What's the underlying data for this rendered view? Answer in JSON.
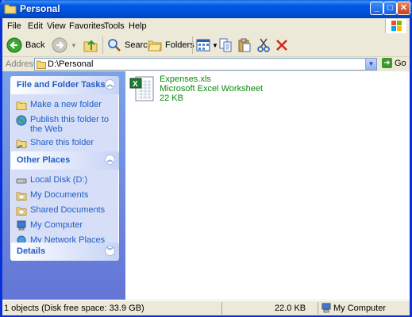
{
  "window": {
    "title": "Personal"
  },
  "menu": [
    "File",
    "Edit",
    "View",
    "Favorites",
    "Tools",
    "Help"
  ],
  "toolbar": {
    "back_label": "Back",
    "search_label": "Search",
    "folders_label": "Folders"
  },
  "address": {
    "label": "Address",
    "value": "D:\\Personal",
    "go_label": "Go"
  },
  "file_folder_tasks": {
    "title": "File and Folder Tasks",
    "items": [
      "Make a new folder",
      "Publish this folder to the Web",
      "Share this folder"
    ]
  },
  "other_places": {
    "title": "Other Places",
    "items": [
      "Local Disk (D:)",
      "My Documents",
      "Shared Documents",
      "My Computer",
      "My Network Places"
    ]
  },
  "details": {
    "title": "Details"
  },
  "files": [
    {
      "name": "Expenses.xls",
      "type": "Microsoft Excel Worksheet",
      "size": "22 KB",
      "icon": "excel-file-icon"
    }
  ],
  "status": {
    "objects": "1 objects (Disk free space: 33.9 GB)",
    "size": "22.0 KB",
    "location": "My Computer"
  },
  "colors": {
    "titlebar": "#0058e6",
    "task_pane": "#6f8ae0",
    "link": "#215dc6",
    "selected_file": "#0a8a0a"
  }
}
